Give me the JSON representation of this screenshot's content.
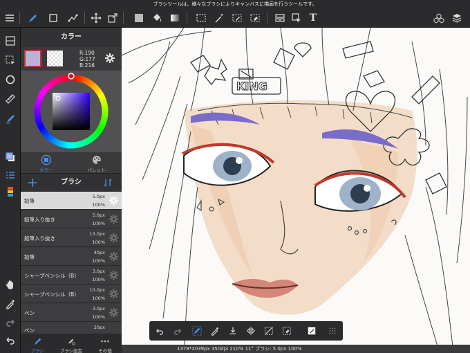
{
  "tooltip": {
    "text": "ブラシツールは、様々なブラシによりキャンバスに描画を行うツールです。"
  },
  "toolbar": {
    "items": [
      "menu-icon",
      "brush-icon",
      "rectangle-icon",
      "connect-icon",
      "move-icon",
      "transform-icon",
      "fill-color-icon",
      "bucket-icon",
      "gradient-icon",
      "selection-rect-icon",
      "magic-wand-icon",
      "selection-pen-icon",
      "selection-eraser-icon",
      "layout-icon",
      "select-layer-icon",
      "text-icon",
      "materials-icon",
      "layers-icon"
    ],
    "text_tool_label": "T"
  },
  "left_tools": [
    "layers-hide-icon",
    "select-icon",
    "rotate-icon",
    "ruler-icon",
    "pen-active-icon",
    "color-swatch-icon",
    "list-icon",
    "palette-stack-icon",
    "hand-icon",
    "eyedropper-icon",
    "redo-icon",
    "undo-icon"
  ],
  "color_panel": {
    "title": "カラー",
    "main_color": "#beb1d8",
    "r": "R:190",
    "g": "G:177",
    "b": "B:216",
    "tabs": [
      {
        "label": "カラー",
        "icon": "color-circle-icon",
        "active": true
      },
      {
        "label": "パレット",
        "icon": "palette-icon",
        "active": false
      }
    ]
  },
  "brush_panel": {
    "title": "ブラシ",
    "brushes": [
      {
        "name": "鉛筆",
        "size": "5.0px",
        "opacity": "100%",
        "selected": true
      },
      {
        "name": "鉛筆入り抜き",
        "size": "5.0px",
        "opacity": "100%",
        "selected": false
      },
      {
        "name": "鉛筆入り抜き",
        "size": "13.0px",
        "opacity": "100%",
        "selected": false
      },
      {
        "name": "鉛筆",
        "size": "40px",
        "opacity": "100%",
        "selected": false
      },
      {
        "name": "シャープペンシル（B）",
        "size": "3.0px",
        "opacity": "100%",
        "selected": false
      },
      {
        "name": "シャープペンシル（B）",
        "size": "10.0px",
        "opacity": "100%",
        "selected": false
      },
      {
        "name": "ペン",
        "size": "3.0px",
        "opacity": "100%",
        "selected": false
      },
      {
        "name": "ペン",
        "size": "20px",
        "opacity": "",
        "selected": false
      }
    ],
    "tabs": [
      {
        "label": "ブラシ",
        "icon": "brush-icon"
      },
      {
        "label": "ブラシ設定",
        "icon": "brush-settings-icon"
      },
      {
        "label": "その他",
        "icon": "more-icon"
      }
    ]
  },
  "canvas": {
    "hairclip_text": "KING"
  },
  "float_toolbar": [
    "undo-icon",
    "redo-icon",
    "pen-select-icon",
    "eyedropper-icon",
    "snap-icon",
    "flip-icon",
    "deselect-icon",
    "eraser-select-icon",
    "fill-layer-icon",
    "grid-icon"
  ],
  "status": {
    "text": "1378*2039px 350dpi 210% 11° ブラシ: 5.0px 100%"
  },
  "colors": {
    "accent": "#4a90e2",
    "toolbar_bg": "#2b2b2d",
    "panel_bg": "#3a3a3c",
    "selected_row": "#d9d9d9"
  }
}
